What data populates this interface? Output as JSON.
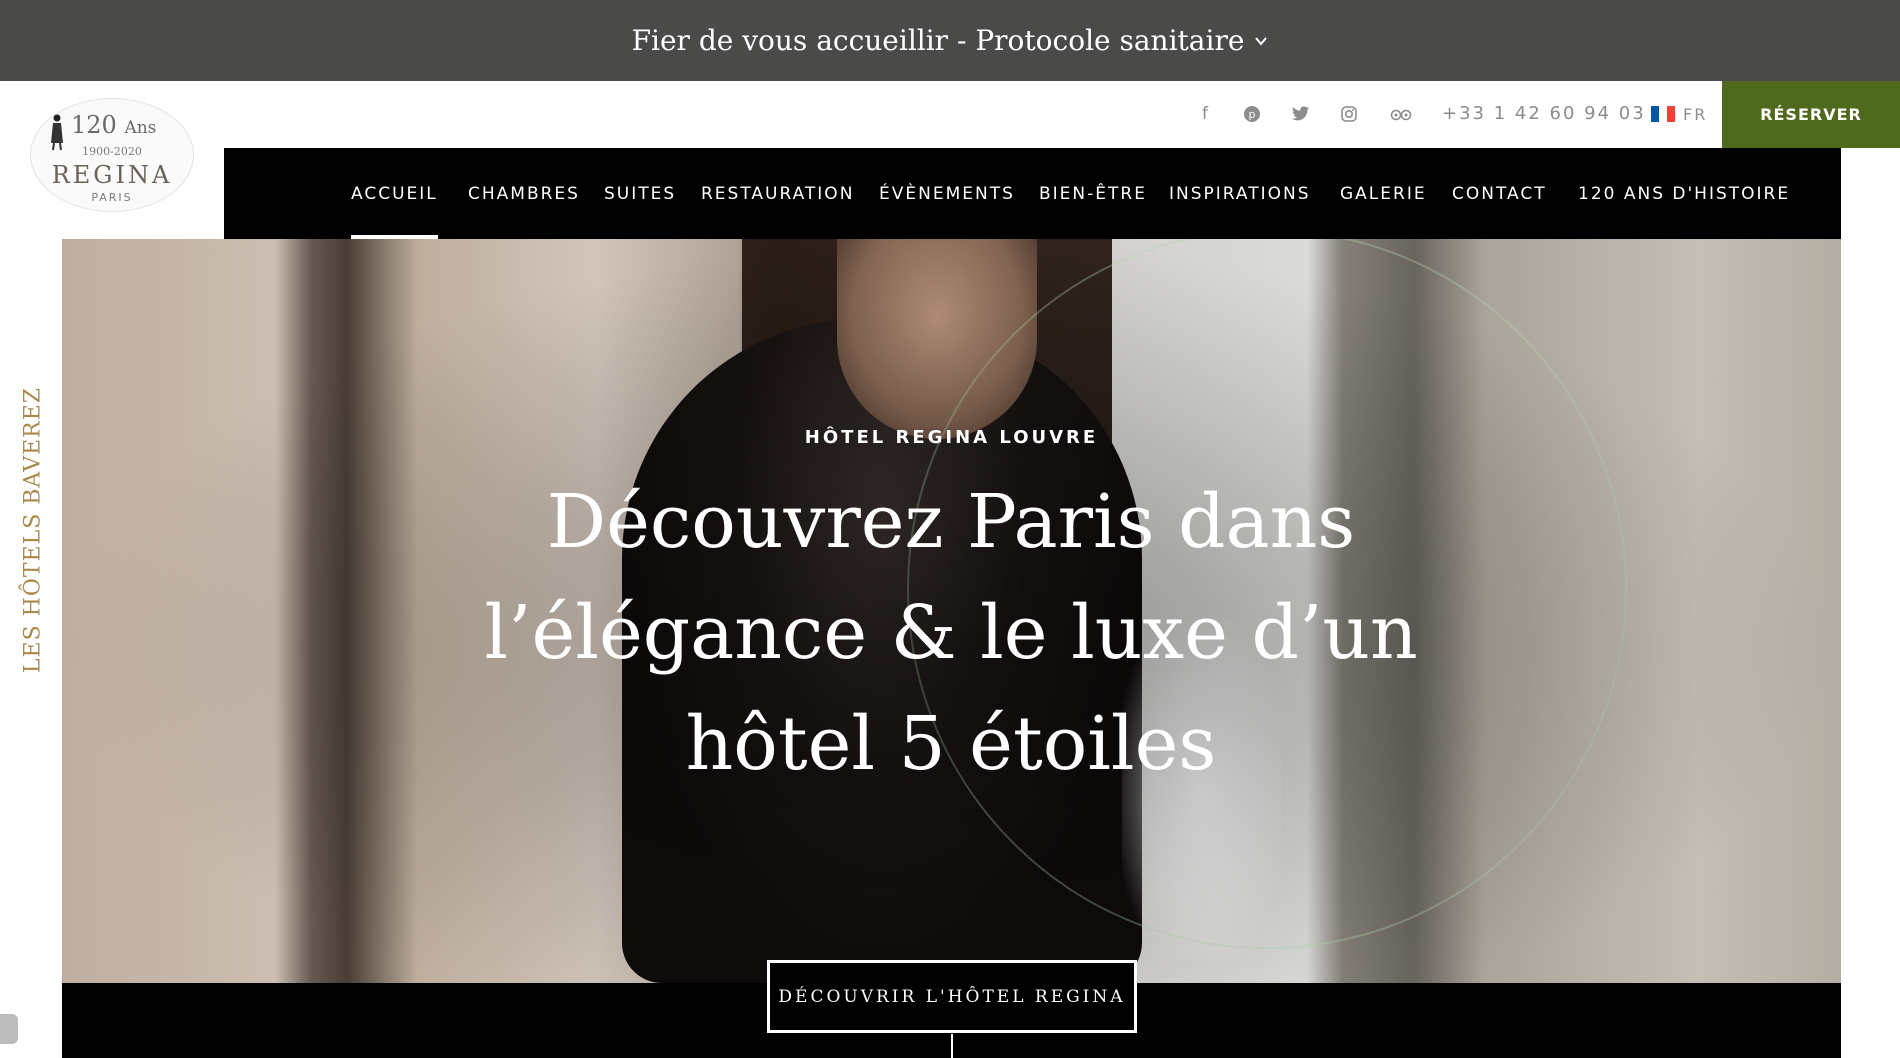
{
  "banner": {
    "text": "Fier de vous accueillir - Protocole sanitaire",
    "icon": "chevron-down-icon"
  },
  "utility": {
    "social": [
      {
        "name": "facebook-icon",
        "glyph": "f"
      },
      {
        "name": "pinterest-icon",
        "glyph": "℗"
      },
      {
        "name": "twitter-icon",
        "glyph": "🐦"
      },
      {
        "name": "instagram-icon",
        "glyph": "◎"
      },
      {
        "name": "tripadvisor-icon",
        "glyph": "◉◉"
      }
    ],
    "phone": "+33 1 42 60 94 03",
    "language": {
      "code": "FR",
      "flag_colors": [
        "#0055a4",
        "#ffffff",
        "#ef4135"
      ]
    },
    "reserve_label": "RÉSERVER"
  },
  "logo": {
    "anniversary": "120",
    "ans": "Ans",
    "years": "1900-2020",
    "name": "REGINA",
    "city": "PARIS"
  },
  "nav": {
    "items": [
      {
        "label": "ACCUEIL",
        "active": true
      },
      {
        "label": "CHAMBRES"
      },
      {
        "label": "SUITES"
      },
      {
        "label": "RESTAURATION"
      },
      {
        "label": "ÉVÈNEMENTS"
      },
      {
        "label": "BIEN-ÊTRE"
      },
      {
        "label": "INSPIRATIONS"
      },
      {
        "label": "GALERIE"
      },
      {
        "label": "CONTACT"
      },
      {
        "label": "120 ANS D'HISTOIRE"
      }
    ]
  },
  "side_label": "LES HÔTELS BAVEREZ",
  "hero": {
    "eyebrow": "HÔTEL REGINA LOUVRE",
    "headline": "Découvrez Paris dans l’élégance & le luxe d’un hôtel 5 étoiles",
    "cta": "DÉCOUVRIR L'HÔTEL REGINA"
  },
  "colors": {
    "banner_bg": "#4a4a49",
    "reserve_bg": "#4f6a1c",
    "nav_bg": "#000000",
    "side_text": "#a98a4a"
  }
}
